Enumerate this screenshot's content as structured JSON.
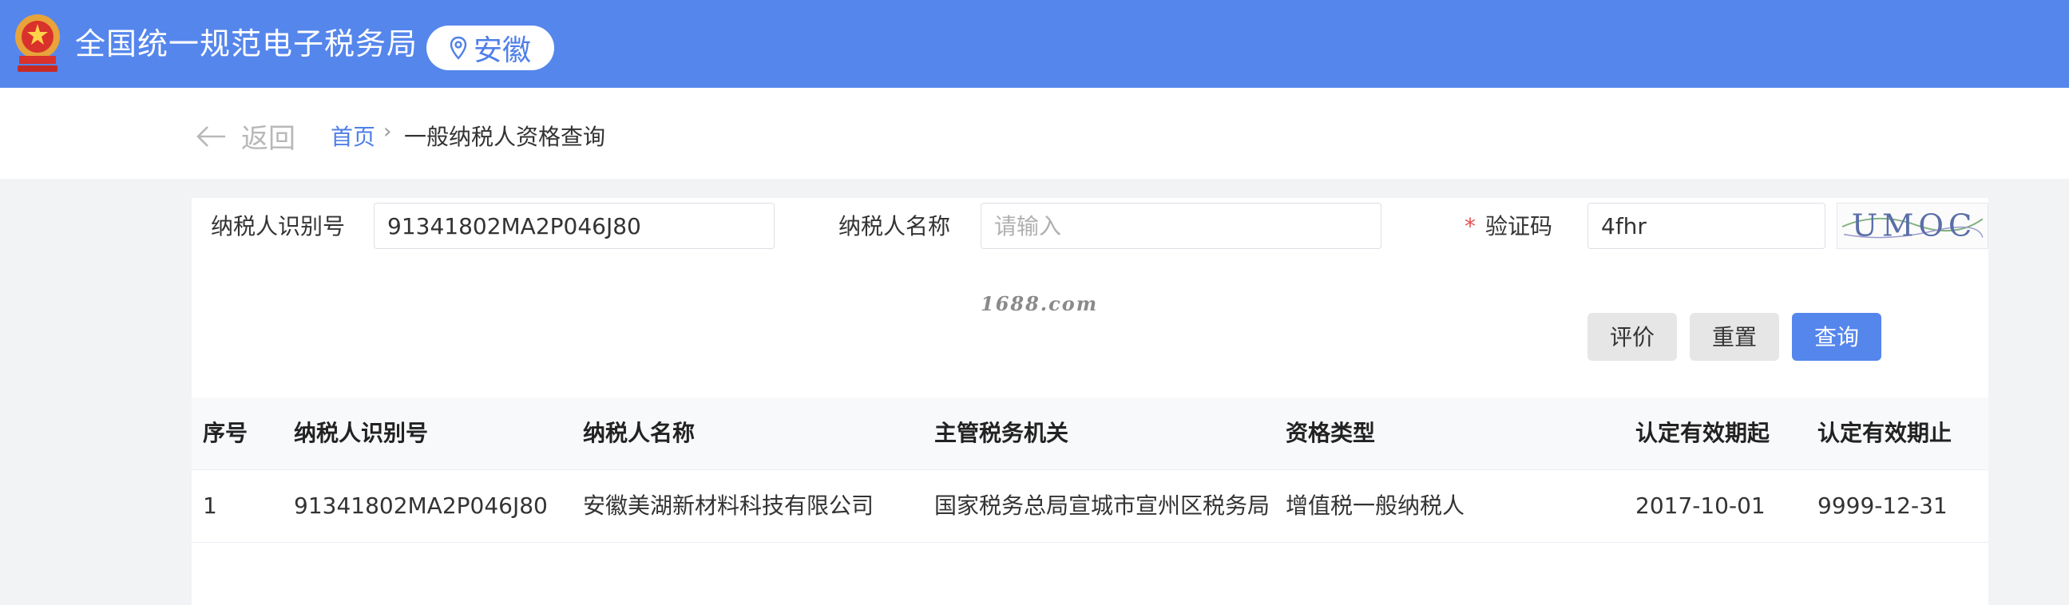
{
  "header": {
    "title": "全国统一规范电子税务局",
    "region": "安徽"
  },
  "breadcrumb": {
    "back_label": "返回",
    "home": "首页",
    "separator": "›",
    "current": "一般纳税人资格查询"
  },
  "form": {
    "taxpayer_id_label": "纳税人识别号",
    "taxpayer_id_value": "91341802MA2P046J80",
    "taxpayer_name_label": "纳税人名称",
    "taxpayer_name_placeholder": "请输入",
    "captcha_required_mark": "*",
    "captcha_label": "验证码",
    "captcha_value": "4fhr",
    "captcha_image_text": "UMOC"
  },
  "watermark": "1688.com",
  "buttons": {
    "evaluate": "评价",
    "reset": "重置",
    "query": "查询"
  },
  "table": {
    "columns": [
      "序号",
      "纳税人识别号",
      "纳税人名称",
      "主管税务机关",
      "资格类型",
      "认定有效期起",
      "认定有效期止"
    ],
    "rows": [
      [
        "1",
        "91341802MA2P046J80",
        "安徽美湖新材料科技有限公司",
        "国家税务总局宣城市宣州区税务局",
        "增值税一般纳税人",
        "2017-10-01",
        "9999-12-31"
      ]
    ]
  },
  "colors": {
    "primary": "#5586ec",
    "page_bg": "#f2f3f5",
    "required": "#e85050"
  }
}
